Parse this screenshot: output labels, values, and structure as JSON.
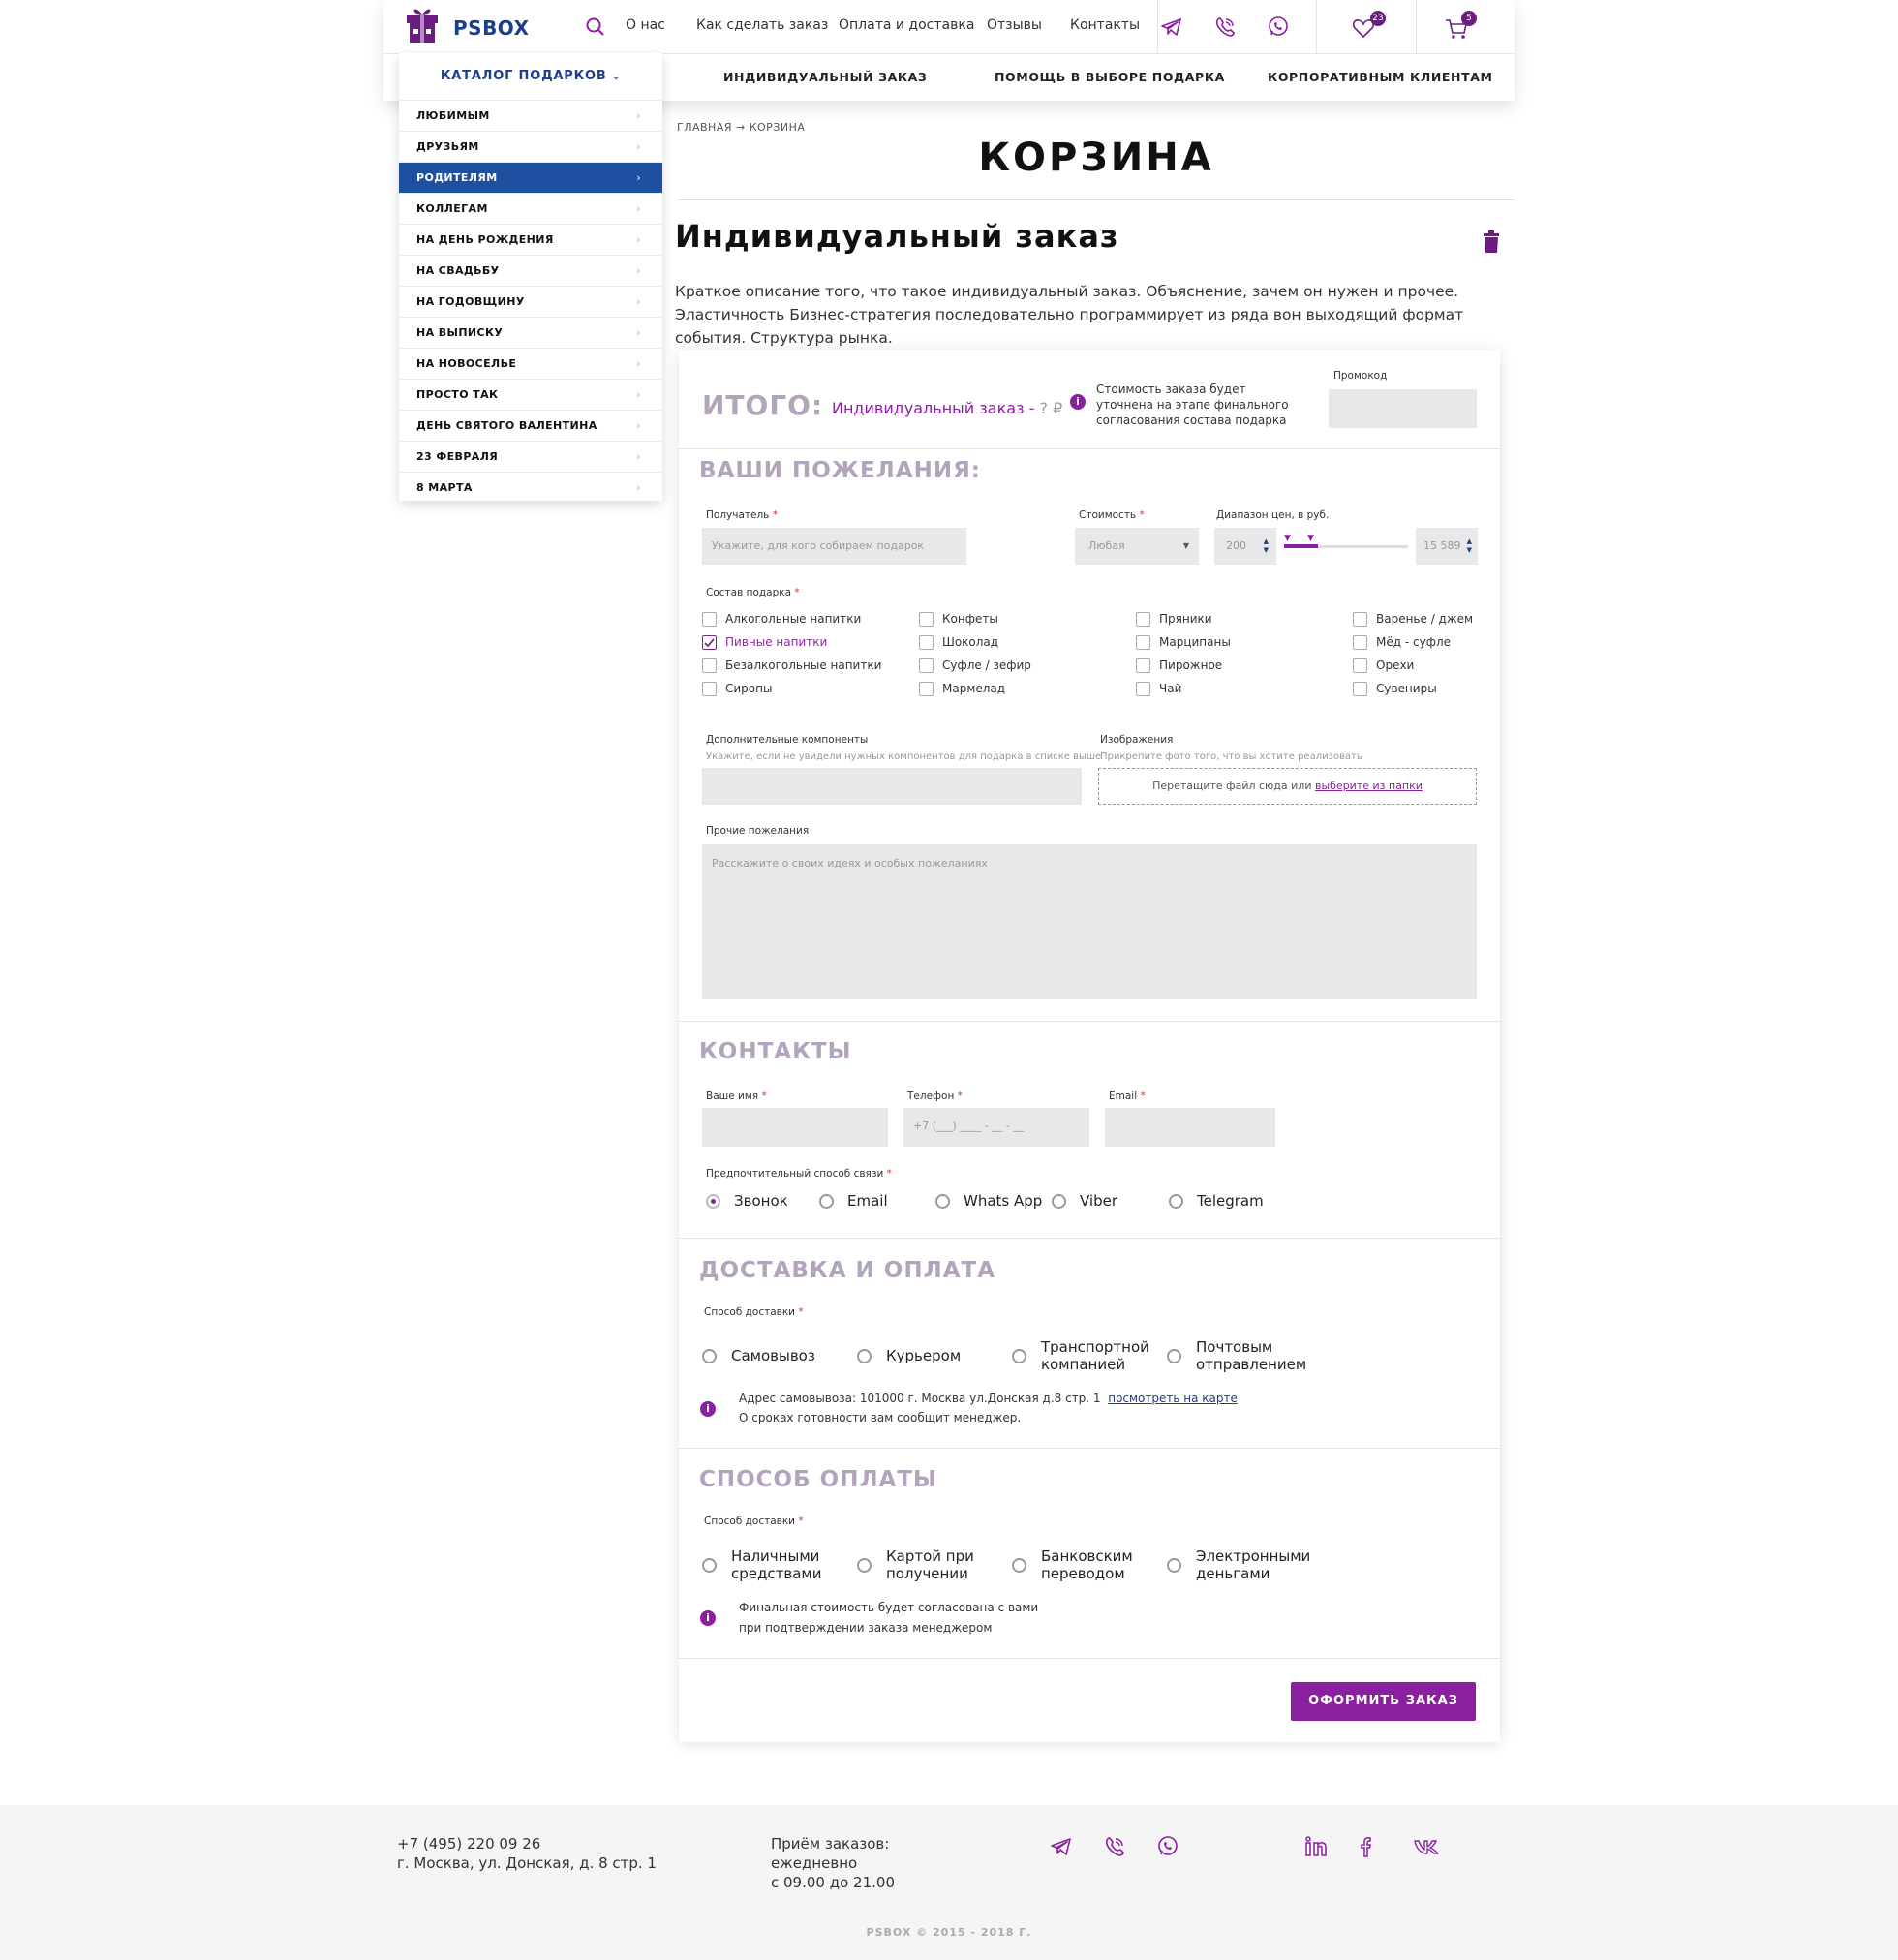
{
  "header": {
    "logo_text": "PSBOX",
    "nav": [
      "О нас",
      "Как сделать заказ",
      "Оплата и доставка",
      "Отзывы",
      "Контакты"
    ],
    "favorites_count": "23",
    "cart_count": "5",
    "subnav": [
      "ИНДИВИДУАЛЬНЫЙ ЗАКАЗ",
      "ПОМОЩЬ В ВЫБОРЕ ПОДАРКА",
      "КОРПОРАТИВНЫМ КЛИЕНТАМ"
    ]
  },
  "catalog": {
    "title": "КАТАЛОГ ПОДАРКОВ",
    "items": [
      "ЛЮБИМЫМ",
      "ДРУЗЬЯМ",
      "РОДИТЕЛЯМ",
      "КОЛЛЕГАМ",
      "НА ДЕНЬ РОЖДЕНИЯ",
      "НА СВАДЬБУ",
      "НА ГОДОВЩИНУ",
      "НА ВЫПИСКУ",
      "НА НОВОСЕЛЬЕ",
      "ПРОСТО ТАК",
      "ДЕНЬ СВЯТОГО ВАЛЕНТИНА",
      "23 ФЕВРАЛЯ",
      "8 МАРТА"
    ],
    "active": "РОДИТЕЛЯМ"
  },
  "breadcrumb": {
    "home": "ГЛАВНАЯ",
    "arrow": "→",
    "current": "КОРЗИНА"
  },
  "page_title": "КОРЗИНА",
  "order": {
    "title": "Индивидуальный заказ",
    "description": "Краткое описание того, что такое индивидуальный заказ. Объяснение, зачем он нужен и прочее. Эластичность Бизнес-стратегия последовательно программирует из ряда вон выходящий формат события. Структура рынка."
  },
  "total": {
    "label": "ИТОГО:",
    "value": "Индивидуальный заказ - ",
    "price": "?",
    "currency": "₽",
    "note": "Стоимость заказа будет уточнена на этапе финального согласования состава подарка",
    "promo_label": "Промокод"
  },
  "wishes": {
    "title": "ВАШИ ПОЖЕЛАНИЯ:",
    "recipient_label": "Получатель",
    "recipient_placeholder": "Укажите, для кого собираем подарок",
    "cost_label": "Стоимость",
    "cost_value": "Любая",
    "range_label": "Диапазон цен, в руб.",
    "range_min": "200",
    "range_max": "15 589",
    "range_fill_fraction_start": 0.0,
    "range_fill_fraction_end": 0.27,
    "composition_label": "Состав подарка",
    "composition": [
      {
        "label": "Алкогольные напитки",
        "checked": false
      },
      {
        "label": "Конфеты",
        "checked": false
      },
      {
        "label": "Пряники",
        "checked": false
      },
      {
        "label": "Варенье / джем",
        "checked": false
      },
      {
        "label": "Пивные напитки",
        "checked": true
      },
      {
        "label": "Шоколад",
        "checked": false
      },
      {
        "label": "Марципаны",
        "checked": false
      },
      {
        "label": "Мёд - суфле",
        "checked": false
      },
      {
        "label": "Безалкогольные напитки",
        "checked": false
      },
      {
        "label": "Суфле / зефир",
        "checked": false
      },
      {
        "label": "Пирожное",
        "checked": false
      },
      {
        "label": "Орехи",
        "checked": false
      },
      {
        "label": "Сиропы",
        "checked": false
      },
      {
        "label": "Мармелад",
        "checked": false
      },
      {
        "label": "Чай",
        "checked": false
      },
      {
        "label": "Сувениры",
        "checked": false
      }
    ],
    "extra_label": "Дополнительные компоненты",
    "extra_hint": "Укажите, если не увидели нужных компонентов для подарка в списке выше",
    "images_label": "Изображения",
    "images_hint": "Прикрепите фото того, что вы хотите реализовать",
    "dropzone_text": "Перетащите файл сюда или ",
    "dropzone_link": "выберите из папки",
    "other_label": "Прочие пожелания",
    "other_placeholder": "Расскажите о своих идеях и особых пожеланиях"
  },
  "contacts": {
    "title": "КОНТАКТЫ",
    "name_label": "Ваше имя",
    "phone_label": "Телефон",
    "phone_placeholder": "+7 (___) ____ - __ - __",
    "email_label": "Email",
    "pref_label": "Предпочтительный способ связи",
    "options": [
      "Звонок",
      "Email",
      "Whats App",
      "Viber",
      "Telegram"
    ],
    "selected": "Звонок"
  },
  "delivery": {
    "title": "ДОСТАВКА И ОПЛАТА",
    "method_label": "Способ доставки",
    "options": [
      [
        "Самовывоз"
      ],
      [
        "Курьером"
      ],
      [
        "Транспортной",
        "компанией"
      ],
      [
        "Почтовым",
        "отправлением"
      ]
    ],
    "address": "Адрес самовывоза: 101000 г. Москва ул.Донская д.8 стр. 1",
    "map_link": "посмотреть на карте",
    "readiness": "О сроках готовности вам сообщит менеджер."
  },
  "payment": {
    "title": "СПОСОБ ОПЛАТЫ",
    "method_label": "Способ доставки",
    "options": [
      [
        "Наличными",
        "средствами"
      ],
      [
        "Картой при",
        "получении"
      ],
      [
        "Банковским",
        "переводом"
      ],
      [
        "Электронными",
        "деньгами"
      ]
    ],
    "note_line1": "Финальная стоимость будет согласована с вами",
    "note_line2": "при подтверждении заказа менеджером"
  },
  "submit_label": "ОФОРМИТЬ ЗАКАЗ",
  "footer": {
    "phone": "+7 (495) 220 09 26",
    "address": "г. Москва, ул. Донская, д. 8 стр. 1",
    "hours_line1": "Приём заказов:",
    "hours_line2": "ежедневно",
    "hours_line3": "с 09.00 до 21.00",
    "copyright": "PSBOX © 2015 - 2018 Г."
  },
  "colors": {
    "brand_blue": "#1d3f8a",
    "accent_purple": "#8a1f9f",
    "section_title": "#b3a4bd",
    "field_bg": "#e8e7ea"
  }
}
